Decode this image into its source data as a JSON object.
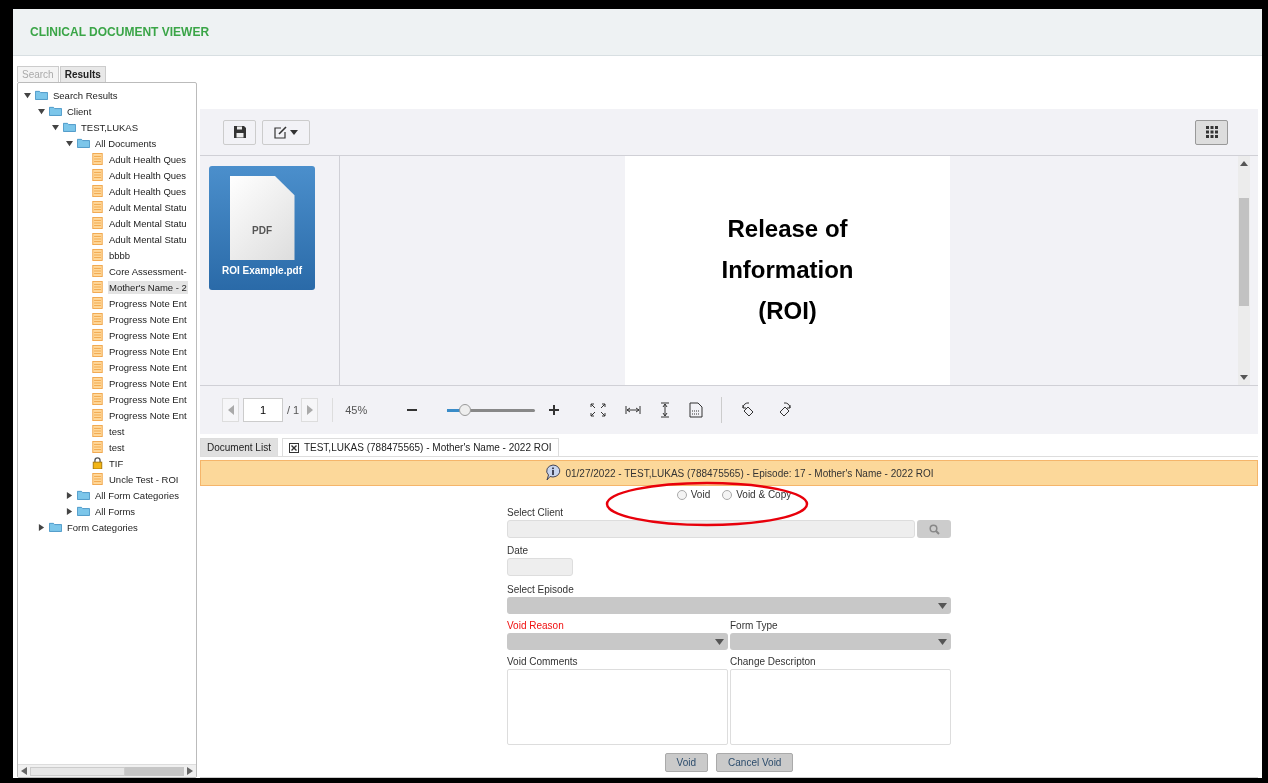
{
  "app": {
    "title": "CLINICAL DOCUMENT VIEWER"
  },
  "side_tabs": [
    {
      "label": "Search",
      "selected": false
    },
    {
      "label": "Results",
      "selected": true
    }
  ],
  "tree": [
    {
      "label": "Search Results",
      "kind": "folder",
      "expanded": true,
      "children": [
        {
          "label": "Client",
          "kind": "folder",
          "expanded": true,
          "children": [
            {
              "label": "TEST,LUKAS",
              "kind": "folder",
              "expanded": true,
              "children": [
                {
                  "label": "All Documents",
                  "kind": "folder",
                  "expanded": true,
                  "children": [
                    {
                      "label": "Adult Health Ques",
                      "kind": "doc",
                      "selected": false
                    },
                    {
                      "label": "Adult Health Ques",
                      "kind": "doc",
                      "selected": false
                    },
                    {
                      "label": "Adult Health Ques",
                      "kind": "doc",
                      "selected": false
                    },
                    {
                      "label": "Adult Mental Statu",
                      "kind": "doc",
                      "selected": false
                    },
                    {
                      "label": "Adult Mental Statu",
                      "kind": "doc",
                      "selected": false
                    },
                    {
                      "label": "Adult Mental Statu",
                      "kind": "doc",
                      "selected": false
                    },
                    {
                      "label": "bbbb",
                      "kind": "doc",
                      "selected": false
                    },
                    {
                      "label": "Core Assessment-",
                      "kind": "doc",
                      "selected": false
                    },
                    {
                      "label": "Mother's Name - 2",
                      "kind": "doc",
                      "selected": true
                    },
                    {
                      "label": "Progress Note Ent",
                      "kind": "doc",
                      "selected": false
                    },
                    {
                      "label": "Progress Note Ent",
                      "kind": "doc",
                      "selected": false
                    },
                    {
                      "label": "Progress Note Ent",
                      "kind": "doc",
                      "selected": false
                    },
                    {
                      "label": "Progress Note Ent",
                      "kind": "doc",
                      "selected": false
                    },
                    {
                      "label": "Progress Note Ent",
                      "kind": "doc",
                      "selected": false
                    },
                    {
                      "label": "Progress Note Ent",
                      "kind": "doc",
                      "selected": false
                    },
                    {
                      "label": "Progress Note Ent",
                      "kind": "doc",
                      "selected": false
                    },
                    {
                      "label": "Progress Note Ent",
                      "kind": "doc",
                      "selected": false
                    },
                    {
                      "label": "test",
                      "kind": "doc",
                      "selected": false
                    },
                    {
                      "label": "test",
                      "kind": "doc",
                      "selected": false
                    },
                    {
                      "label": "TIF",
                      "kind": "lock",
                      "selected": false
                    },
                    {
                      "label": "Uncle Test  - ROI",
                      "kind": "doc",
                      "selected": false
                    }
                  ]
                },
                {
                  "label": "All Form Categories",
                  "kind": "folder",
                  "expanded": false
                },
                {
                  "label": "All Forms",
                  "kind": "folder",
                  "expanded": false
                }
              ]
            }
          ]
        },
        {
          "label": "Form Categories",
          "kind": "folder",
          "expanded": false
        }
      ]
    }
  ],
  "viewer": {
    "thumbnails": [
      {
        "type_label": "PDF",
        "name": "ROI Example.pdf",
        "selected": true
      }
    ],
    "page_text": "Release of Information (ROI)",
    "page_number": "1",
    "page_total": "/ 1",
    "zoom": "45%",
    "zoom_slider": {
      "level": 0.2
    }
  },
  "doc_tabs": [
    {
      "label": "Document List",
      "kind": "plain",
      "selected": false
    },
    {
      "label": "TEST,LUKAS (788475565) - Mother's Name - 2022 ROI",
      "kind": "closable",
      "selected": true
    }
  ],
  "info_bar": "01/27/2022 - TEST,LUKAS (788475565) - Episode: 17 - Mother's Name - 2022 ROI",
  "void_options": [
    {
      "label": "Void",
      "selected": false
    },
    {
      "label": "Void & Copy",
      "selected": false
    }
  ],
  "form_rows": [
    [
      {
        "label": "Select Client",
        "kind": "lookup",
        "required": false
      }
    ],
    [
      {
        "label": "Date",
        "kind": "date",
        "required": false
      }
    ],
    [
      {
        "label": "Select Episode",
        "kind": "select",
        "required": false
      }
    ],
    [
      {
        "label": "Void Reason",
        "kind": "select",
        "required": true
      },
      {
        "label": "Form Type",
        "kind": "select",
        "required": false
      }
    ],
    [
      {
        "label": "Void Comments",
        "kind": "textarea",
        "required": false
      },
      {
        "label": "Change Descripton",
        "kind": "textarea",
        "required": false
      }
    ]
  ],
  "buttons": [
    "Void",
    "Cancel Void"
  ]
}
